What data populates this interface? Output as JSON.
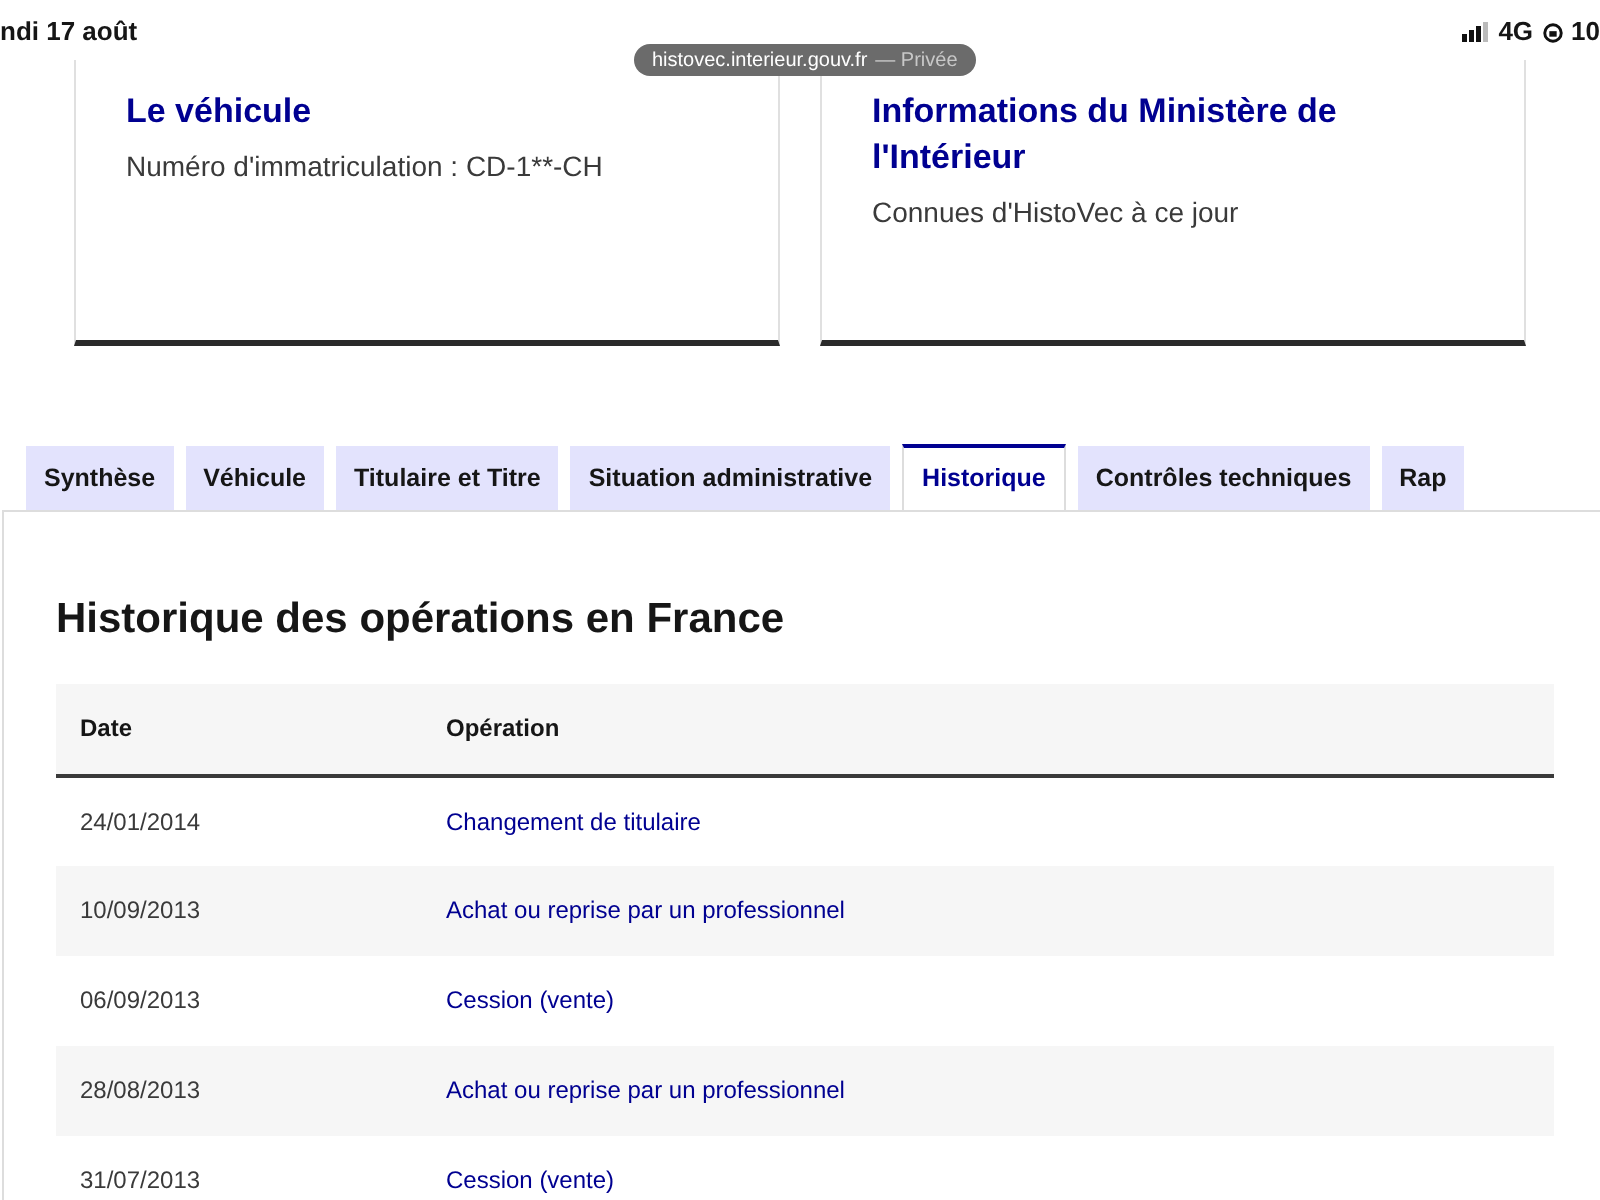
{
  "status_bar": {
    "date": "ndi 17 août",
    "url": "histovec.interieur.gouv.fr",
    "privacy": "— Privée",
    "network": "4G",
    "battery": "10"
  },
  "cards": [
    {
      "title": "Le véhicule",
      "text": "Numéro d'immatriculation : CD-1**-CH"
    },
    {
      "title": "Informations du Ministère de l'Intérieur",
      "text": "Connues d'HistoVec à ce jour"
    }
  ],
  "tabs": [
    {
      "label": "Synthèse",
      "selected": false
    },
    {
      "label": "Véhicule",
      "selected": false
    },
    {
      "label": "Titulaire et Titre",
      "selected": false
    },
    {
      "label": "Situation administrative",
      "selected": false
    },
    {
      "label": "Historique",
      "selected": true
    },
    {
      "label": "Contrôles techniques",
      "selected": false
    },
    {
      "label": "Rap",
      "selected": false
    }
  ],
  "section_title": "Historique des opérations en France",
  "table": {
    "columns": [
      "Date",
      "Opération"
    ],
    "rows": [
      [
        "24/01/2014",
        "Changement de titulaire"
      ],
      [
        "10/09/2013",
        "Achat ou reprise par un professionnel"
      ],
      [
        "06/09/2013",
        "Cession (vente)"
      ],
      [
        "28/08/2013",
        "Achat ou reprise par un professionnel"
      ],
      [
        "31/07/2013",
        "Cession (vente)"
      ]
    ]
  }
}
